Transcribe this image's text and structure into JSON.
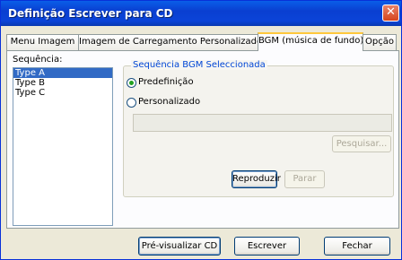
{
  "window": {
    "title": "Definição Escrever para CD",
    "close_glyph": "✕"
  },
  "tabs": [
    {
      "label": "Menu Imagem",
      "active": false
    },
    {
      "label": "Imagem de Carregamento Personalizado",
      "active": false
    },
    {
      "label": "BGM (música de fundo)",
      "active": true
    },
    {
      "label": "Opção",
      "active": false
    }
  ],
  "sequence": {
    "label": "Sequência:",
    "items": [
      "Type A",
      "Type B",
      "Type C"
    ],
    "selected": "Type A"
  },
  "bgm_group": {
    "legend": "Sequência BGM Seleccionada",
    "option_default": "Predefinição",
    "option_custom": "Personalizado",
    "selected_option": "Predefinição",
    "path_value": "",
    "browse_label": "Pesquisar...",
    "play_label": "Reproduzir",
    "stop_label": "Parar"
  },
  "footer": {
    "preview_label": "Pré-visualizar CD",
    "write_label": "Escrever",
    "close_label": "Fechar"
  }
}
